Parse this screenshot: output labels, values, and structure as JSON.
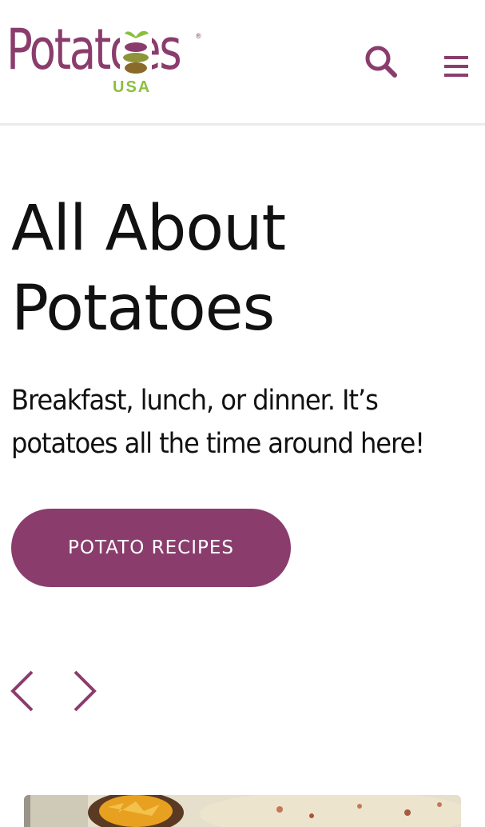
{
  "header": {
    "logo": {
      "word": "Potatoes",
      "registered": "®",
      "sub": "USA"
    },
    "search_icon": "search-icon",
    "menu_icon": "hamburger-menu-icon"
  },
  "hero": {
    "title": "All About Potatoes",
    "subtitle": "Breakfast, lunch, or dinner. It’s potatoes all the time around here!",
    "cta_label": "POTATO RECIPES"
  },
  "carousel": {
    "prev_icon": "chevron-left-icon",
    "next_icon": "chevron-right-icon"
  },
  "colors": {
    "brand": "#8a3d6d",
    "accent_green": "#8cbf3f",
    "text": "#111111",
    "divider": "#ebebeb"
  }
}
